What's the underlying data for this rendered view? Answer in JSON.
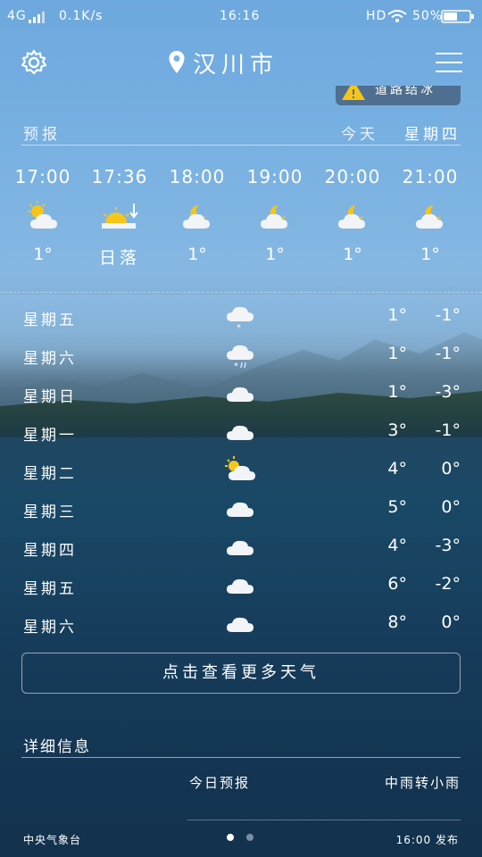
{
  "status_bar": {
    "network": "4G",
    "speed": "0.1K/s",
    "time": "16:16",
    "hd": "HD",
    "battery": "50%"
  },
  "header": {
    "city": "汉川市",
    "settings_icon": "gear-icon",
    "menu_icon": "menu-icon",
    "location_icon": "location-pin-icon"
  },
  "alert": {
    "text": "道路结冰",
    "icon": "warning-icon"
  },
  "forecast_header": {
    "label": "预报",
    "today": "今天",
    "weekday": "星期四"
  },
  "hourly": [
    {
      "time": "17:00",
      "icon": "sun-cloud-icon",
      "temp": "1°"
    },
    {
      "time": "17:36",
      "icon": "sunset-icon",
      "temp": "日落"
    },
    {
      "time": "18:00",
      "icon": "moon-cloud-icon",
      "temp": "1°"
    },
    {
      "time": "19:00",
      "icon": "moon-cloud-icon",
      "temp": "1°"
    },
    {
      "time": "20:00",
      "icon": "moon-cloud-icon",
      "temp": "1°"
    },
    {
      "time": "21:00",
      "icon": "moon-cloud-icon",
      "temp": "1°"
    }
  ],
  "daily": [
    {
      "day": "星期五",
      "icon": "snow-cloud-icon",
      "high": "1°",
      "low": "-1°"
    },
    {
      "day": "星期六",
      "icon": "sleet-cloud-icon",
      "high": "1°",
      "low": "-1°"
    },
    {
      "day": "星期日",
      "icon": "cloud-icon",
      "high": "1°",
      "low": "-3°"
    },
    {
      "day": "星期一",
      "icon": "cloud-icon",
      "high": "3°",
      "low": "-1°"
    },
    {
      "day": "星期二",
      "icon": "sun-cloud-icon",
      "high": "4°",
      "low": "0°"
    },
    {
      "day": "星期三",
      "icon": "cloud-icon",
      "high": "5°",
      "low": "0°"
    },
    {
      "day": "星期四",
      "icon": "cloud-icon",
      "high": "4°",
      "low": "-3°"
    },
    {
      "day": "星期五",
      "icon": "cloud-icon",
      "high": "6°",
      "low": "-2°"
    },
    {
      "day": "星期六",
      "icon": "cloud-icon",
      "high": "8°",
      "low": "0°"
    }
  ],
  "more_button": "点击查看更多天气",
  "details": {
    "title": "详细信息",
    "forecast_label": "今日预报",
    "forecast_value": "中雨转小雨"
  },
  "footer": {
    "source": "中央气象台",
    "published": "16:00 发布"
  },
  "colors": {
    "sky_top": "#6da8de",
    "deep_lake": "#102a44",
    "alert_bg": "#4e6f8f",
    "warning_yellow": "#f5c518"
  }
}
